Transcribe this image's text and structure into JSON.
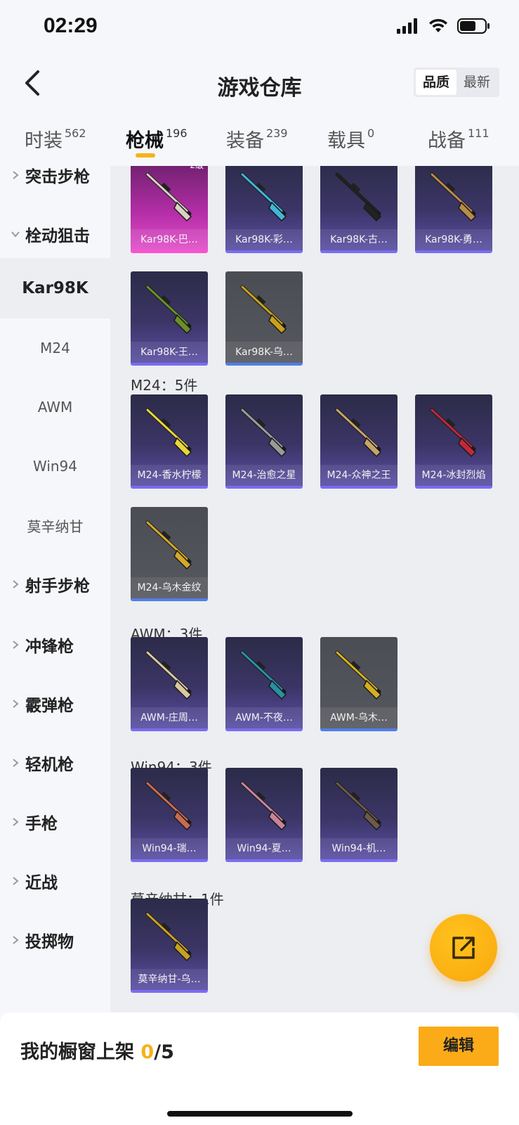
{
  "status_bar": {
    "time": "02:29"
  },
  "header": {
    "title": "游戏仓库",
    "sort_options": [
      "品质",
      "最新"
    ],
    "active_sort": "品质"
  },
  "tabs": [
    {
      "label": "时装",
      "count": "562"
    },
    {
      "label": "枪械",
      "count": "196"
    },
    {
      "label": "装备",
      "count": "239"
    },
    {
      "label": "载具",
      "count": "0"
    },
    {
      "label": "战备",
      "count": "111"
    }
  ],
  "sidebar": {
    "items": [
      {
        "label": "突击步枪",
        "type": "group",
        "expanded": false
      },
      {
        "label": "栓动狙击",
        "type": "group",
        "expanded": true
      },
      {
        "label": "Kar98K",
        "type": "sub",
        "active": true
      },
      {
        "label": "M24",
        "type": "sub"
      },
      {
        "label": "AWM",
        "type": "sub"
      },
      {
        "label": "Win94",
        "type": "sub"
      },
      {
        "label": "莫辛纳甘",
        "type": "sub"
      },
      {
        "label": "射手步枪",
        "type": "group",
        "expanded": false
      },
      {
        "label": "冲锋枪",
        "type": "group",
        "expanded": false
      },
      {
        "label": "霰弹枪",
        "type": "group",
        "expanded": false
      },
      {
        "label": "轻机枪",
        "type": "group",
        "expanded": false
      },
      {
        "label": "手枪",
        "type": "group",
        "expanded": false
      },
      {
        "label": "近战",
        "type": "group",
        "expanded": false
      },
      {
        "label": "投掷物",
        "type": "group",
        "expanded": false
      }
    ]
  },
  "sections": [
    {
      "title": "",
      "items": [
        {
          "name": "Kar98K-巴…",
          "rarity": "pink",
          "level": "2级"
        },
        {
          "name": "Kar98K-彩…",
          "rarity": "purple"
        },
        {
          "name": "Kar98K-古…",
          "rarity": "purple"
        },
        {
          "name": "Kar98K-勇…",
          "rarity": "purple"
        },
        {
          "name": "Kar98K-王…",
          "rarity": "purple"
        },
        {
          "name": "Kar98K-乌…",
          "rarity": "grey"
        }
      ]
    },
    {
      "title": "M24：5件",
      "items": [
        {
          "name": "M24-香水柠檬",
          "rarity": "purple"
        },
        {
          "name": "M24-治愈之星",
          "rarity": "purple"
        },
        {
          "name": "M24-众神之王",
          "rarity": "purple"
        },
        {
          "name": "M24-冰封烈焰",
          "rarity": "purple"
        },
        {
          "name": "M24-乌木金纹",
          "rarity": "grey"
        }
      ]
    },
    {
      "title": "AWM：3件",
      "items": [
        {
          "name": "AWM-庄周…",
          "rarity": "purple"
        },
        {
          "name": "AWM-不夜…",
          "rarity": "purple"
        },
        {
          "name": "AWM-乌木…",
          "rarity": "grey"
        }
      ]
    },
    {
      "title": "Win94：3件",
      "items": [
        {
          "name": "Win94-瑞…",
          "rarity": "purple"
        },
        {
          "name": "Win94-夏…",
          "rarity": "purple"
        },
        {
          "name": "Win94-机…",
          "rarity": "purple"
        }
      ]
    },
    {
      "title": "莫辛纳甘：1件",
      "items": [
        {
          "name": "莫辛纳甘-乌…",
          "rarity": "purple"
        }
      ]
    }
  ],
  "bottom": {
    "shelf_label": "我的橱窗上架",
    "shelf_current": "0",
    "shelf_total": "/5",
    "edit_label": "编辑"
  },
  "colors": {
    "accent": "#f5b21a",
    "edit_button": "#fbab18",
    "purple_rarity": "#7a6cf2",
    "pink_rarity": "#ff4fd0",
    "grey_rarity_bar": "#4f7fe8"
  },
  "icons": {
    "back": "back-arrow-icon",
    "fab": "share-external-icon"
  }
}
